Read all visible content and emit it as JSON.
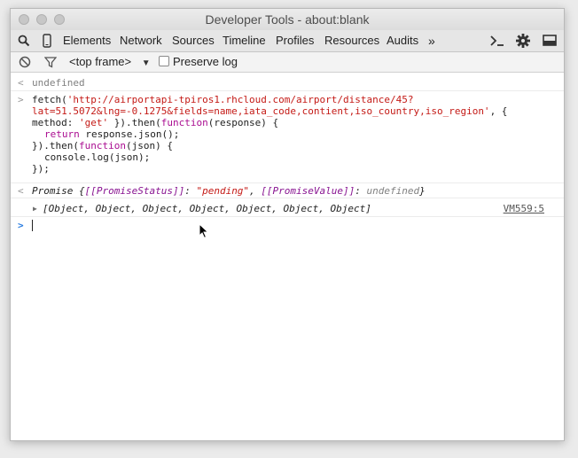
{
  "window": {
    "title": "Developer Tools - about:blank"
  },
  "toolbar": {
    "tabs": [
      "Elements",
      "Network",
      "Sources",
      "Timeline",
      "Profiles",
      "Resources",
      "Audits"
    ],
    "more": "»",
    "icons": [
      "search-icon",
      "device-icon",
      "console-drawer-icon",
      "gear-icon",
      "dock-icon"
    ]
  },
  "console_bar": {
    "frame_label": "<top frame>",
    "frame_arrow": "▼",
    "preserve_log_label": "Preserve log",
    "preserve_log_checked": false
  },
  "console": {
    "entry1": {
      "text": "undefined"
    },
    "fetch": {
      "l1_pre": "fetch(",
      "l1_url": "'http://airportapi-tpiros1.rhcloud.com/airport/distance/45?",
      "l2_url": "lat=51.5072&lng=-0.1275&fields=name,iata_code,contient,iso_country,iso_region'",
      "l2_post": ", {",
      "l3_pre": "method: ",
      "l3_str": "'get'",
      "l3_mid": " }).then(",
      "l3_kw": "function",
      "l3_post": "(response) {",
      "l4_kw": "return",
      "l4_post": " response.json();",
      "l5_pre": "}).then(",
      "l5_kw": "function",
      "l5_post": "(json) {",
      "l6": "console.log(json);",
      "l7": "});"
    },
    "promise": {
      "label": "Promise {",
      "status_key": "[[PromiseStatus]]",
      "colon1": ": ",
      "status_val": "\"pending\"",
      "comma": ", ",
      "value_key": "[[PromiseValue]]",
      "colon2": ": ",
      "value_val": "undefined",
      "close": "}"
    },
    "array": {
      "arrow": "▶",
      "text": "[Object, Object, Object, Object, Object, Object, Object]",
      "source": "VM559:5"
    },
    "prompt": ">"
  },
  "colors": {
    "string": "#c41a16",
    "keyword": "#aa0d91",
    "property": "#881391",
    "prompt": "#2a7de1"
  }
}
